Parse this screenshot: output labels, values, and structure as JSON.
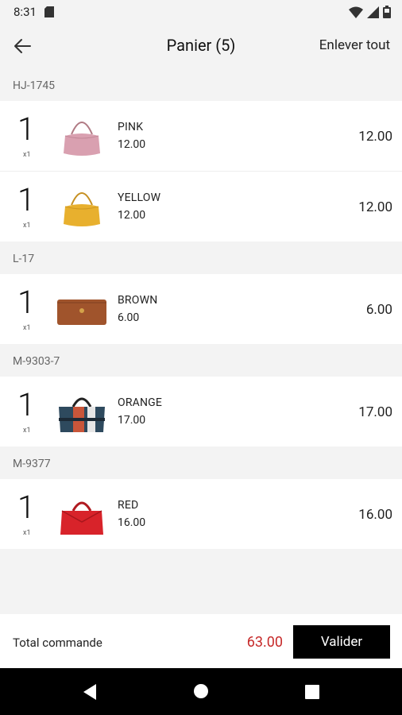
{
  "status": {
    "time": "8:31"
  },
  "appbar": {
    "title": "Panier (5)",
    "clear_label": "Enlever tout"
  },
  "groups": [
    {
      "code": "HJ-1745",
      "items": [
        {
          "qty": "1",
          "mult": "x1",
          "name": "PINK",
          "unit_price": "12.00",
          "price": "12.00",
          "color": "#d9a0b0"
        },
        {
          "qty": "1",
          "mult": "x1",
          "name": "YELLOW",
          "unit_price": "12.00",
          "price": "12.00",
          "color": "#e8b02e"
        }
      ]
    },
    {
      "code": "L-17",
      "items": [
        {
          "qty": "1",
          "mult": "x1",
          "name": "BROWN",
          "unit_price": "6.00",
          "price": "6.00",
          "color": "#a0542c"
        }
      ]
    },
    {
      "code": "M-9303-7",
      "items": [
        {
          "qty": "1",
          "mult": "x1",
          "name": "ORANGE",
          "unit_price": "17.00",
          "price": "17.00",
          "color": "#2e4a5e"
        }
      ]
    },
    {
      "code": "M-9377",
      "items": [
        {
          "qty": "1",
          "mult": "x1",
          "name": "RED",
          "unit_price": "16.00",
          "price": "16.00",
          "color": "#d8232a"
        }
      ]
    }
  ],
  "footer": {
    "total_label": "Total commande",
    "total_value": "63.00",
    "submit_label": "Valider"
  },
  "icons": {
    "back": "arrow-left-icon",
    "wifi": "wifi-icon",
    "signal": "signal-icon",
    "battery": "battery-icon"
  },
  "colors": {
    "accent": "#c62828",
    "button": "#000000"
  }
}
